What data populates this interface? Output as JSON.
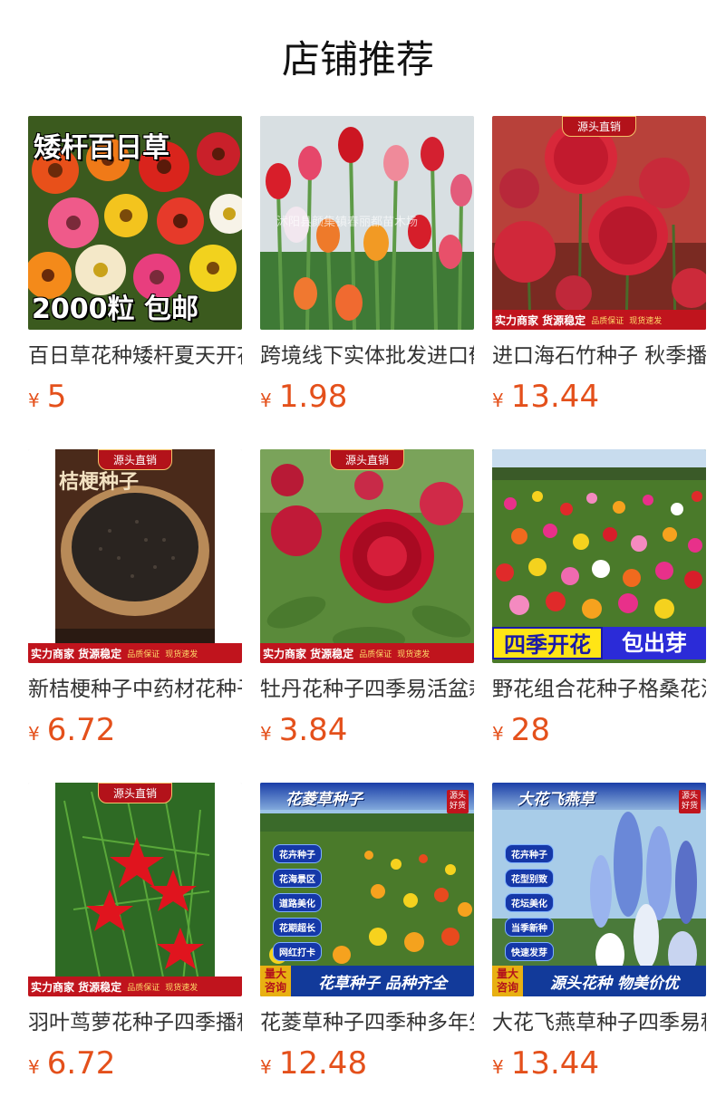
{
  "page": {
    "title": "店铺推荐"
  },
  "currency_symbol": "¥",
  "products": [
    {
      "name": "百日草花种矮杆夏天开花",
      "price": "5",
      "overlay_title": "矮杆百日草",
      "overlay_bottom": "2000粒  包邮"
    },
    {
      "name": "跨境线下实体批发进口郁金香",
      "price": "1.98",
      "watermark": "沭阳县颜集镇春丽都苗木场"
    },
    {
      "name": "进口海石竹种子 秋季播种",
      "price": "13.44",
      "ribbon": "源头直销",
      "bar_main": "实力商家 货源稳定",
      "bar_tag1": "品质保证",
      "bar_tag2": "现货速发"
    },
    {
      "name": "新桔梗种子中药材花种子",
      "price": "6.72",
      "ribbon": "源头直销",
      "overlay_title": "桔梗种子",
      "bar_main": "实力商家 货源稳定",
      "bar_tag1": "品质保证",
      "bar_tag2": "现货速发"
    },
    {
      "name": "牡丹花种子四季易活盆栽",
      "price": "3.84",
      "ribbon": "源头直销",
      "bar_main": "实力商家 货源稳定",
      "bar_tag1": "品质保证",
      "bar_tag2": "现货速发"
    },
    {
      "name": "野花组合花种子格桑花混合",
      "price": "28",
      "banner_left": "四季开花",
      "banner_right": "包出芽"
    },
    {
      "name": "羽叶茑萝花种子四季播种",
      "price": "6.72",
      "ribbon": "源头直销",
      "bar_main": "实力商家 货源稳定",
      "bar_tag1": "品质保证",
      "bar_tag2": "现货速发"
    },
    {
      "name": "花菱草种子四季种多年生",
      "price": "12.48",
      "top_title": "花菱草种子",
      "corner_tag": "源头好货",
      "features": [
        "花卉种子",
        "花海景区",
        "道路美化",
        "花期超长",
        "网红打卡"
      ],
      "badge": "量大咨询",
      "slogan": "花草种子  品种齐全"
    },
    {
      "name": "大花飞燕草种子四季易种",
      "price": "13.44",
      "top_title": "大花飞燕草",
      "corner_tag": "源头好货",
      "features": [
        "花卉种子",
        "花型别致",
        "花坛美化",
        "当季新种",
        "快速发芽"
      ],
      "badge": "量大咨询",
      "slogan": "源头花种  物美价优"
    }
  ],
  "colors": {
    "price": "#e4501b",
    "bar_red": "#c0141d",
    "promo_blue": "#123a9a"
  }
}
